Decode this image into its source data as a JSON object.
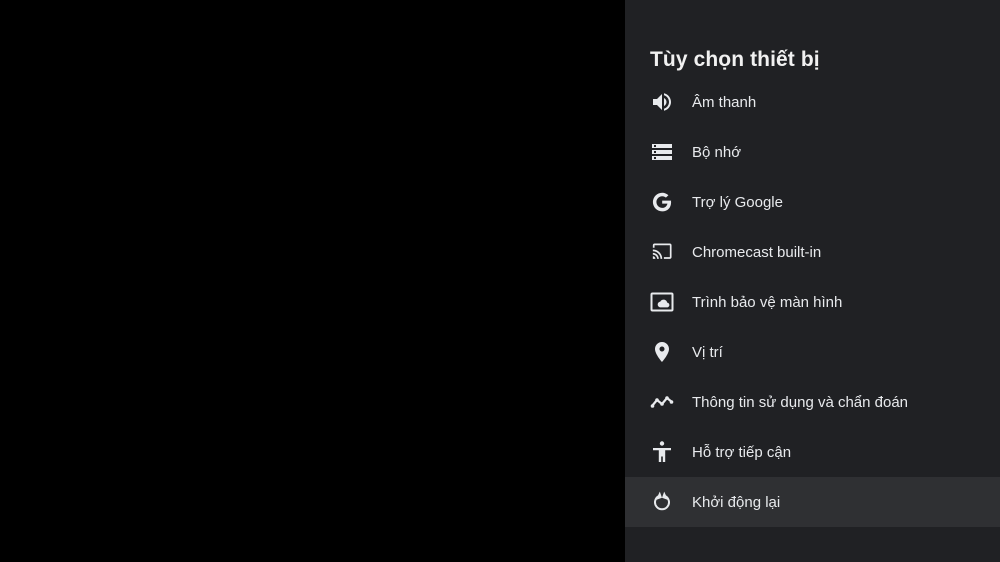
{
  "panel": {
    "title": "Tùy chọn thiết bị",
    "background": "#202124",
    "focus_color": "#2f3033",
    "items": [
      {
        "label": "Âm thanh",
        "icon": "volume-icon"
      },
      {
        "label": "Bộ nhớ",
        "icon": "storage-icon"
      },
      {
        "label": "Trợ lý Google",
        "icon": "google-icon"
      },
      {
        "label": "Chromecast built-in",
        "icon": "cast-icon"
      },
      {
        "label": "Trình bảo vệ màn hình",
        "icon": "screensaver-icon"
      },
      {
        "label": "Vị trí",
        "icon": "location-pin-icon"
      },
      {
        "label": "Thông tin sử dụng và chẩn đoán",
        "icon": "diagnostics-chart-icon"
      },
      {
        "label": "Hỗ trợ tiếp cận",
        "icon": "accessibility-icon"
      },
      {
        "label": "Khởi động lại",
        "icon": "restart-icon",
        "focused": true
      }
    ]
  }
}
